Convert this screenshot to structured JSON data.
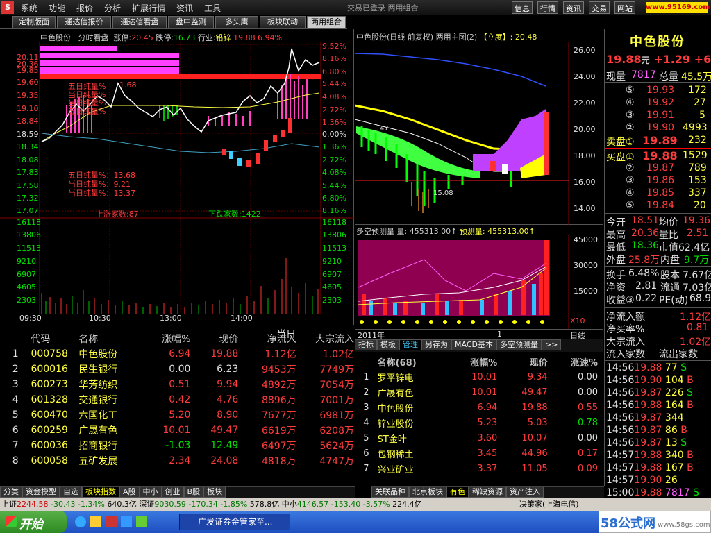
{
  "menu": {
    "items": [
      "系统",
      "功能",
      "报价",
      "分析",
      "扩展行情",
      "资讯",
      "工具"
    ],
    "window_title": "交易已登录 两用组合",
    "right_buttons": [
      "信息",
      "行情",
      "资讯",
      "交易",
      "网站"
    ]
  },
  "top_tabs": [
    "定制版面",
    "通达信报价",
    "通达信看盘",
    "盘中监测",
    "多头鹰",
    "板块联动",
    "两用组合"
  ],
  "intraday": {
    "header": {
      "name": "中色股份",
      "mode": "分时看盘",
      "up_limit_label": "涨停:",
      "up_limit": "20.45",
      "down_limit_label": "跌停:",
      "down_limit": "16.73",
      "industry_label": "行业:",
      "industry": "铅锌",
      "ind_val": "19.88",
      "ind_pct": "6.94%"
    },
    "price_left": [
      "20.36",
      "20.11",
      "19.85",
      "19.60",
      "19.35",
      "19.10",
      "18.84",
      "18.59",
      "18.34",
      "18.08",
      "17.83",
      "17.58",
      "17.32",
      "17.07"
    ],
    "price_right": [
      "9.52%",
      "8.16%",
      "6.80%",
      "5.44%",
      "4.08%",
      "2.72%",
      "1.36%",
      "0.00%",
      "1.36%",
      "2.72%",
      "4.08%",
      "5.44%",
      "6.80%",
      "8.16%"
    ],
    "legend_top": [
      "五日纯量%",
      "当日纯量%",
      "当日纯量%",
      "五日纯量%"
    ],
    "legend_top_val": "1.68",
    "legend_bottom": [
      "五日纯量%：13.68",
      "当日纯量%：9.21",
      "当日纯量%：13.37"
    ],
    "up_count": "上涨家数:87",
    "down_count": "下跌家数:1422",
    "vol_axis": [
      "16118",
      "13806",
      "11513",
      "9210",
      "6907",
      "4605",
      "2303"
    ],
    "time_axis": [
      "09:30",
      "10:30",
      "13:00",
      "14:00"
    ]
  },
  "daily": {
    "header": "中色股份(日线 前复权) 两用主图(2)",
    "tag": "【立度】",
    "tag_val": ": 20.48",
    "price_axis": [
      "26.00",
      "24.00",
      "22.00",
      "20.00",
      "18.00",
      "16.00",
      "14.00"
    ],
    "low_label": "15.08",
    "hi_label": "47",
    "sub_header": "多空预测量 量: 455313.00↑",
    "sub_header2": "预测量: 455313.00↑",
    "sub_axis": [
      "45000",
      "30000",
      "15000"
    ],
    "x10": "X10",
    "year": "2011年",
    "year_n": "1",
    "period": "日线"
  },
  "indicator_tabs": [
    "指标",
    "模板",
    "管理",
    "另存为",
    "MACD基本",
    "多空预测量",
    ">>"
  ],
  "left_table": {
    "date_label": "当日",
    "headers": [
      "代码",
      "名称",
      "涨幅%",
      "现价",
      "净流入",
      "大宗流入"
    ],
    "rows": [
      [
        "1",
        "000758",
        "中色股份",
        "6.94",
        "19.88",
        "1.12亿",
        "1.02亿"
      ],
      [
        "2",
        "600016",
        "民生银行",
        "0.00",
        "6.23",
        "9453万",
        "7749万"
      ],
      [
        "3",
        "600273",
        "华芳纺织",
        "0.51",
        "9.94",
        "4892万",
        "7054万"
      ],
      [
        "4",
        "601328",
        "交通银行",
        "0.42",
        "4.76",
        "8896万",
        "7001万"
      ],
      [
        "5",
        "600470",
        "六国化工",
        "5.20",
        "8.90",
        "7677万",
        "6981万"
      ],
      [
        "6",
        "600259",
        "广晟有色",
        "10.01",
        "49.47",
        "6619万",
        "6208万"
      ],
      [
        "7",
        "600036",
        "招商银行",
        "-1.03",
        "12.49",
        "6497万",
        "5624万"
      ],
      [
        "8",
        "600058",
        "五矿发展",
        "2.34",
        "24.08",
        "4818万",
        "4747万"
      ]
    ]
  },
  "right_table": {
    "headers": [
      "名称",
      "(68)",
      "涨幅%",
      "现价",
      "涨速%"
    ],
    "rows": [
      [
        "1",
        "罗平锌电",
        "10.01",
        "9.34",
        "0.00"
      ],
      [
        "2",
        "广晟有色",
        "10.01",
        "49.47",
        "0.00"
      ],
      [
        "3",
        "中色股份",
        "6.94",
        "19.88",
        "0.55"
      ],
      [
        "4",
        "锌业股份",
        "5.23",
        "5.03",
        "-0.78"
      ],
      [
        "5",
        "ST金叶",
        "3.60",
        "10.07",
        "0.00"
      ],
      [
        "6",
        "包钢稀土",
        "3.45",
        "44.96",
        "0.17"
      ],
      [
        "7",
        "兴业矿业",
        "3.37",
        "11.05",
        "0.09"
      ]
    ]
  },
  "bottom_tabs_left": [
    "分类",
    "资金模型",
    "自选",
    "板块指数",
    "A股",
    "中小",
    "创业",
    "B股",
    "板块"
  ],
  "bottom_tabs_right": [
    "关联品种",
    "北京板块",
    "有色",
    "稀缺资源",
    "资产注入"
  ],
  "quote": {
    "name": "中色股份",
    "price": "19.88",
    "unit": "元",
    "chg": "+1.29",
    "pct": "+6.94",
    "xl_label": "现量",
    "xl": "7817",
    "zl_label": "总量",
    "zl": "45.5万",
    "sell": [
      [
        "⑤",
        "19.93",
        "172"
      ],
      [
        "④",
        "19.92",
        "27"
      ],
      [
        "③",
        "19.91",
        "5"
      ],
      [
        "②",
        "19.90",
        "4993"
      ],
      [
        "卖盘①",
        "19.89",
        "232"
      ]
    ],
    "buy": [
      [
        "买盘①",
        "19.88",
        "1529"
      ],
      [
        "②",
        "19.87",
        "789"
      ],
      [
        "③",
        "19.86",
        "153"
      ],
      [
        "④",
        "19.85",
        "337"
      ],
      [
        "⑤",
        "19.84",
        "20"
      ]
    ],
    "stats": [
      [
        "今开",
        "18.51",
        "均价",
        "19.36"
      ],
      [
        "最高",
        "20.36",
        "量比",
        "2.51"
      ],
      [
        "最低",
        "18.36",
        "市值",
        "62.4亿"
      ],
      [
        "外盘",
        "25.8万",
        "内盘",
        "9.7万"
      ],
      [
        "换手",
        "6.48%",
        "股本",
        "7.67亿"
      ],
      [
        "净资",
        "2.81",
        "流通",
        "7.03亿"
      ],
      [
        "收益③",
        "0.22",
        "PE(动)",
        "68.9"
      ]
    ],
    "flow": [
      [
        "净流入额",
        "1.12亿"
      ],
      [
        "净买率%",
        "0.81"
      ],
      [
        "大宗流入",
        "1.02亿"
      ],
      [
        "流入家数",
        "流出家数"
      ]
    ],
    "ticks": [
      [
        "14:56",
        "19.88",
        "77",
        "S"
      ],
      [
        "14:56",
        "19.90",
        "104",
        "B"
      ],
      [
        "14:56",
        "19.87",
        "226",
        "S"
      ],
      [
        "14:56",
        "19.88",
        "164",
        "B"
      ],
      [
        "14:56",
        "19.87",
        "344",
        ""
      ],
      [
        "14:56",
        "19.87",
        "86",
        "B"
      ],
      [
        "14:56",
        "19.87",
        "13",
        "S"
      ],
      [
        "14:57",
        "19.88",
        "340",
        "B"
      ],
      [
        "14:57",
        "19.88",
        "167",
        "B"
      ],
      [
        "14:57",
        "19.90",
        "26",
        ""
      ],
      [
        "15:00",
        "19.88",
        "7817",
        "S"
      ]
    ]
  },
  "status": {
    "sh_label": "上证",
    "sh": "2244.58",
    "sh_chg": "-30.43",
    "sh_pct": "-1.34%",
    "sh_amt": "640.3亿",
    "sz_label": "深证",
    "sz": "9030.59",
    "sz_chg": "-170.34",
    "sz_pct": "-1.85%",
    "sz_amt": "578.8亿",
    "zx_label": "中小",
    "zx": "4146.57",
    "zx_chg": "-153.40",
    "zx_pct": "-3.57%",
    "zx_amt": "224.4亿",
    "right": "决策家(上海电信)"
  },
  "taskbar": {
    "start": "开始",
    "task": "广发证券金管家至...",
    "watermark": "58公式网",
    "url": "www.58gs.com"
  }
}
